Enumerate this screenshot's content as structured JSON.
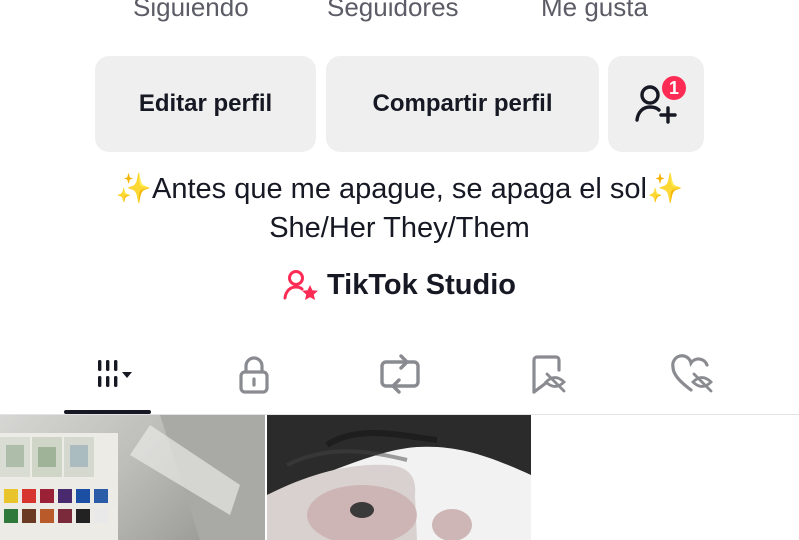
{
  "stats": {
    "following_label": "Siguiendo",
    "followers_label": "Seguidores",
    "likes_label": "Me gusta"
  },
  "actions": {
    "edit_label": "Editar perfil",
    "share_label": "Compartir perfil",
    "add_friends_icon": "person-add-icon",
    "notification_count": "1"
  },
  "bio": {
    "line1": "Antes que me apague, se apaga el sol",
    "sparkle": "✨",
    "line2": "She/Her They/Them"
  },
  "studio": {
    "label": "TikTok Studio",
    "icon": "creator-star-icon",
    "icon_color": "#fe2c55"
  },
  "tabs": [
    {
      "name": "videos",
      "icon": "grid-icon",
      "active": true
    },
    {
      "name": "private",
      "icon": "lock-icon",
      "active": false
    },
    {
      "name": "reposts",
      "icon": "repost-icon",
      "active": false
    },
    {
      "name": "favorites",
      "icon": "bookmark-hidden-icon",
      "active": false
    },
    {
      "name": "liked",
      "icon": "heart-hidden-icon",
      "active": false
    }
  ],
  "videos": [
    {
      "thumbnail": "watercolor-paint-set"
    },
    {
      "thumbnail": "black-and-white-portrait"
    }
  ]
}
